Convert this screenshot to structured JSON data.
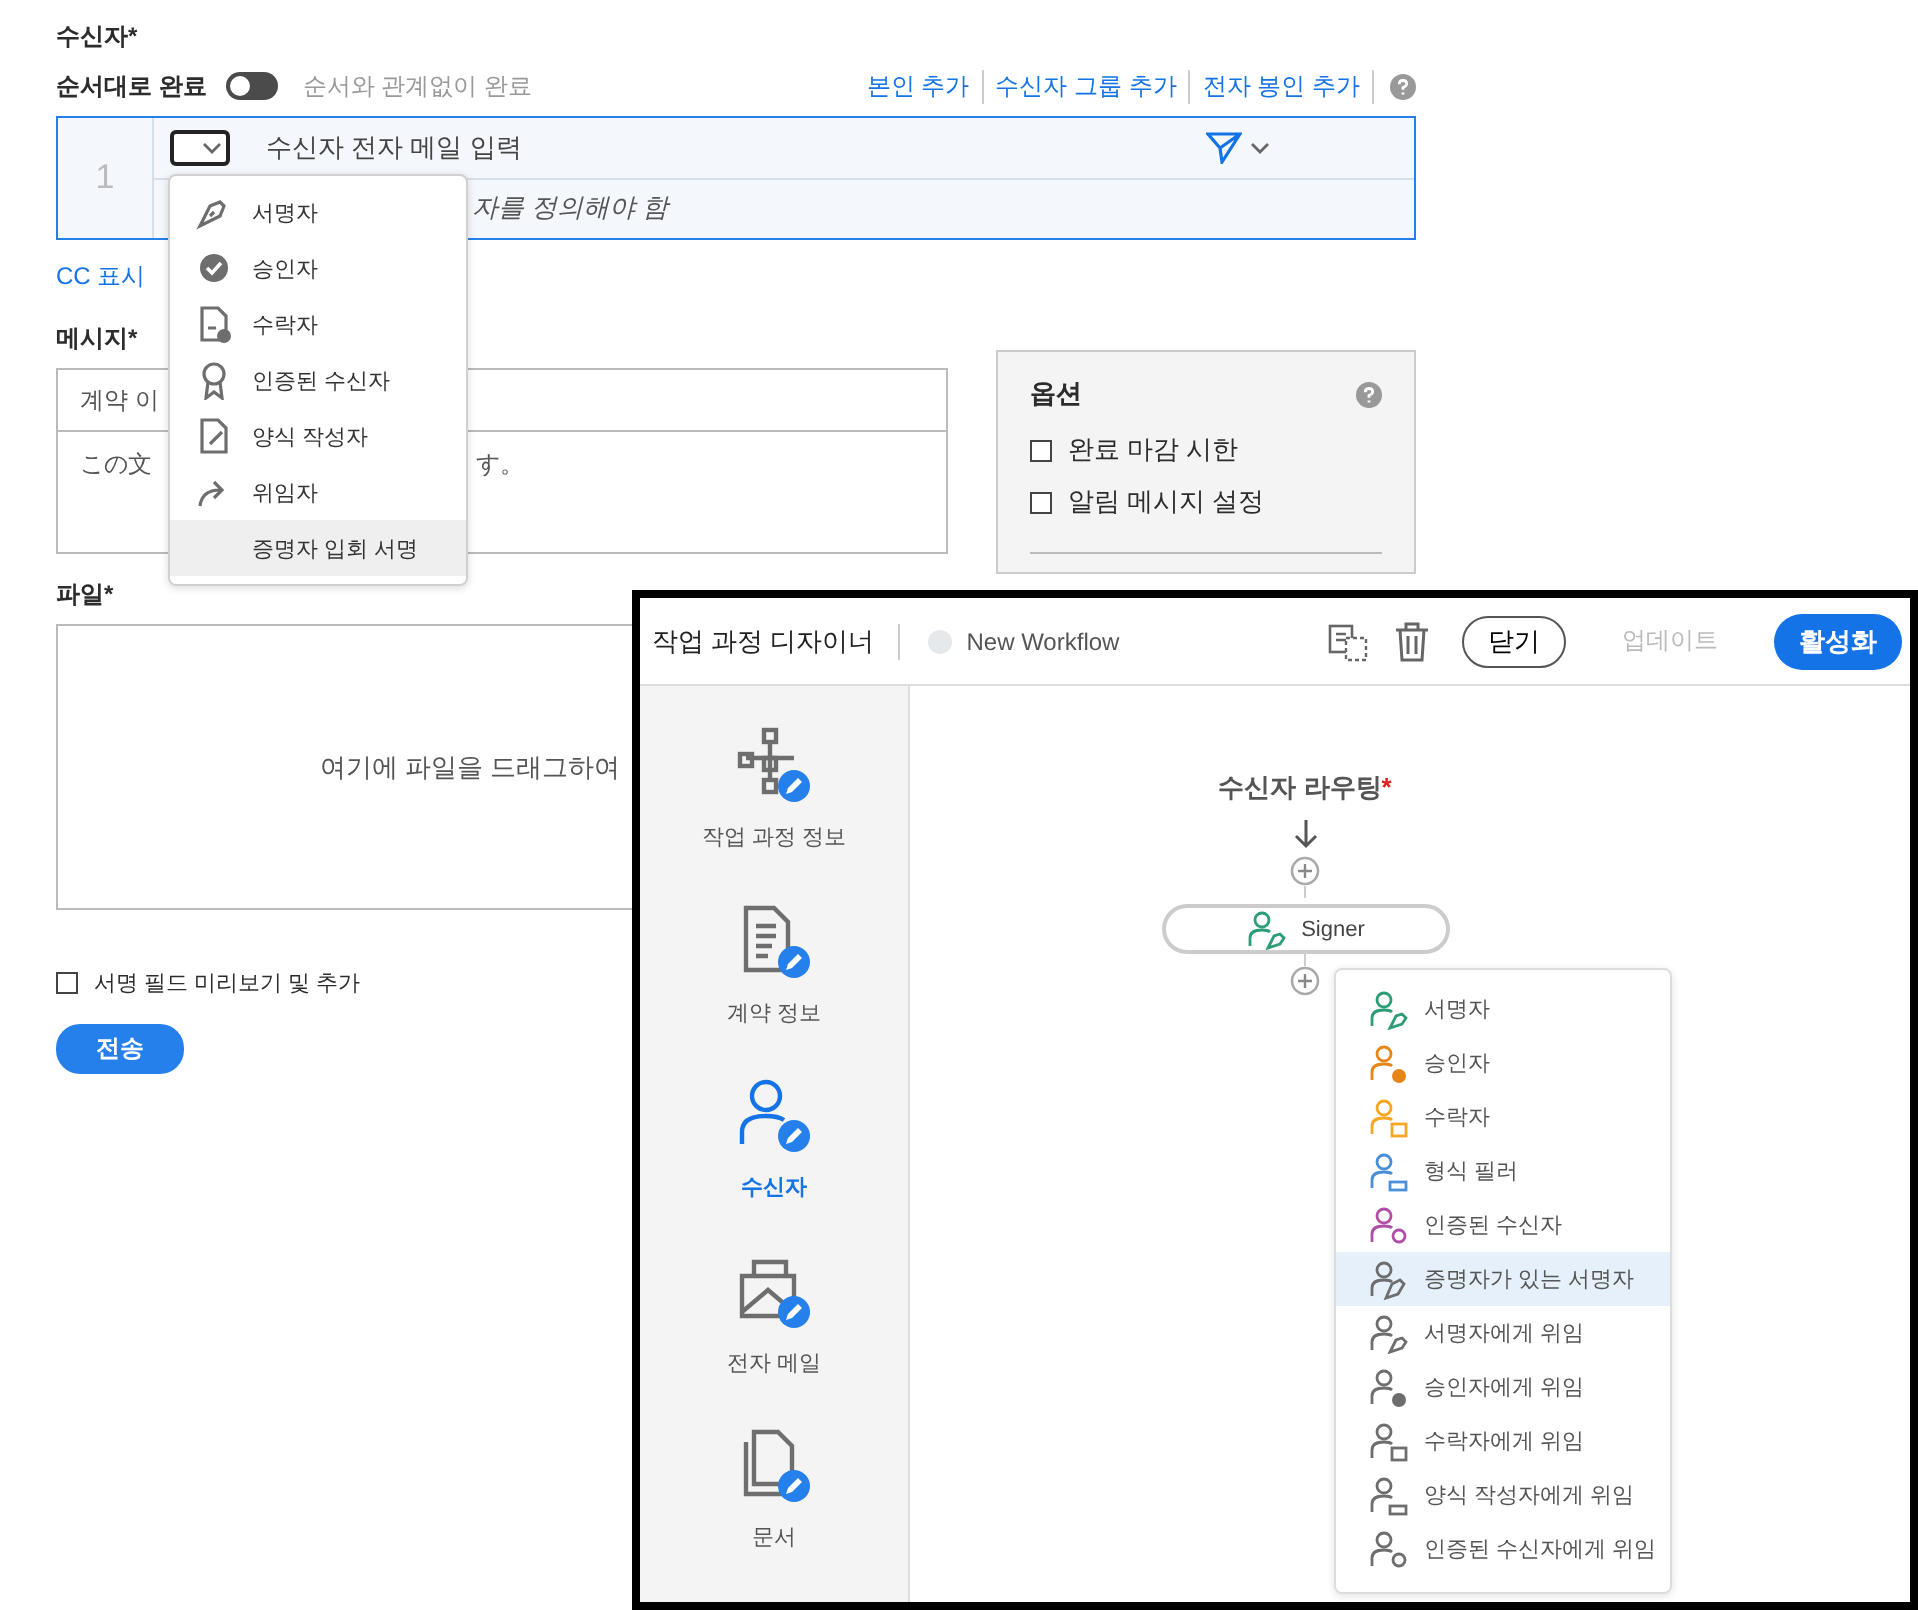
{
  "recipients": {
    "label": "수신자*",
    "order_toggle": {
      "label": "순서대로 완료",
      "on": false,
      "alt_label": "순서와 관계없이 완료"
    },
    "links": [
      "본인 추가",
      "수신자 그룹 추가",
      "전자 봉인 추가"
    ],
    "row": {
      "number": "1",
      "email_placeholder": "수신자 전자 메일 입력",
      "hint": "자를 정의해야 함"
    },
    "cc_link": "CC 표시"
  },
  "role_menu": [
    {
      "label": "서명자",
      "selected": false
    },
    {
      "label": "승인자",
      "selected": false
    },
    {
      "label": "수락자",
      "selected": false
    },
    {
      "label": "인증된 수신자",
      "selected": false
    },
    {
      "label": "양식 작성자",
      "selected": false
    },
    {
      "label": "위임자",
      "selected": false
    },
    {
      "label": "증명자 입회 서명",
      "selected": true
    }
  ],
  "message": {
    "label": "메시지*",
    "name_value": "계약 이",
    "body_start": "この文",
    "body_end": "す。"
  },
  "options": {
    "title": "옵션",
    "items": [
      {
        "label": "완료 마감 시한",
        "checked": false
      },
      {
        "label": "알림 메시지 설정",
        "checked": false
      }
    ]
  },
  "file": {
    "label": "파일*",
    "drop_text": "여기에 파일을 드래그하여"
  },
  "preview_option": {
    "label": "서명 필드 미리보기 및 추가",
    "checked": false
  },
  "send_button": "전송",
  "designer": {
    "title": "작업 과정 디자이너",
    "workflow_name": "New Workflow",
    "close_button": "닫기",
    "update_button": {
      "label": "업데이트",
      "disabled": true
    },
    "activate_button": "활성화",
    "sidebar": [
      {
        "label": "작업 과정 정보",
        "selected": false
      },
      {
        "label": "계약 정보",
        "selected": false
      },
      {
        "label": "수신자",
        "selected": true
      },
      {
        "label": "전자 메일",
        "selected": false
      },
      {
        "label": "문서",
        "selected": false
      }
    ],
    "routing": {
      "title": "수신자 라우팅",
      "required_mark": "*",
      "node": "Signer"
    },
    "add_menu": [
      {
        "label": "서명자",
        "color": "#2d9d78",
        "selected": false
      },
      {
        "label": "승인자",
        "color": "#e68619",
        "selected": false
      },
      {
        "label": "수락자",
        "color": "#f5a623",
        "selected": false
      },
      {
        "label": "형식 필러",
        "color": "#4a90d9",
        "selected": false
      },
      {
        "label": "인증된 수신자",
        "color": "#b04fa8",
        "selected": false
      },
      {
        "label": "증명자가 있는 서명자",
        "color": "#6e6e6e",
        "selected": true
      },
      {
        "label": "서명자에게 위임",
        "color": "#6e6e6e",
        "selected": false
      },
      {
        "label": "승인자에게 위임",
        "color": "#6e6e6e",
        "selected": false
      },
      {
        "label": "수락자에게 위임",
        "color": "#6e6e6e",
        "selected": false
      },
      {
        "label": "양식 작성자에게 위임",
        "color": "#6e6e6e",
        "selected": false
      },
      {
        "label": "인증된 수신자에게 위임",
        "color": "#6e6e6e",
        "selected": false
      }
    ]
  }
}
